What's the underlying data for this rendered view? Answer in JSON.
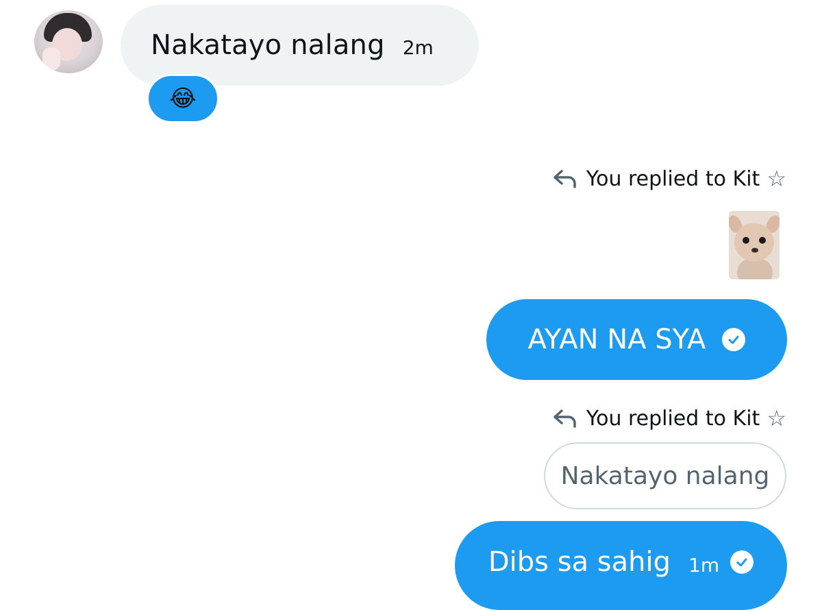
{
  "incoming": {
    "message": "Nakatayo nalang",
    "time": "2m",
    "reaction_emoji": "😂"
  },
  "outgoing": [
    {
      "reply_label": "You replied to Kit",
      "reply_suffix": "☆",
      "attachment": "dog-photo",
      "message": "AYAN NA SYA",
      "status_icon": "check-circle-icon"
    },
    {
      "reply_label": "You replied to Kit",
      "reply_suffix": "☆",
      "quoted_text": "Nakatayo nalang",
      "message": "Dibs sa sahig",
      "time": "1m",
      "status_icon": "check-circle-icon"
    }
  ],
  "colors": {
    "accent": "#1d9bf0",
    "incoming_bubble": "#eff3f4",
    "muted": "#536471"
  }
}
